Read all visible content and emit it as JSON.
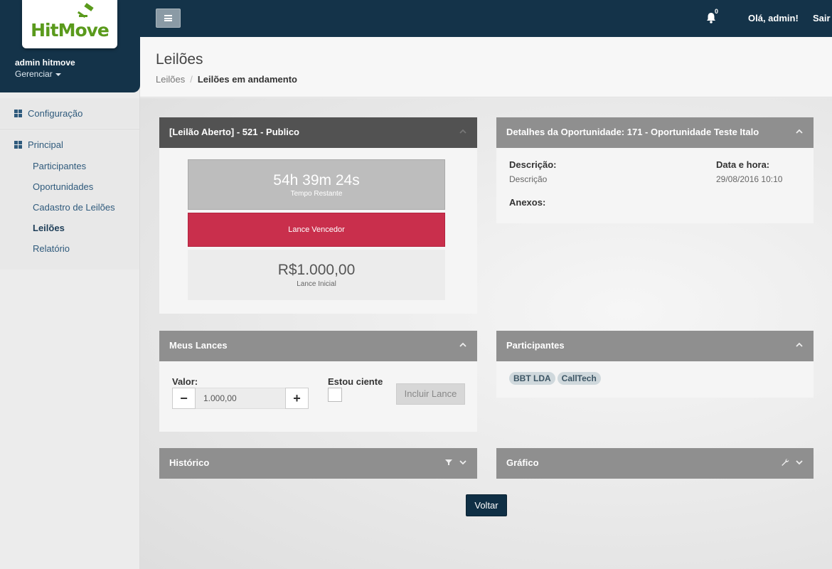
{
  "topbar": {
    "notification_count": "0",
    "greeting": "Olá, admin!",
    "logout_label": "Sair"
  },
  "sidebar": {
    "logo_text": "HitMove",
    "profile_name": "admin hitmove",
    "profile_menu": "Gerenciar",
    "sections": [
      {
        "label": "Configuração",
        "icon": "grid-icon"
      },
      {
        "label": "Principal",
        "icon": "grid-icon"
      }
    ],
    "items": [
      {
        "label": "Participantes"
      },
      {
        "label": "Oportunidades"
      },
      {
        "label": "Cadastro de Leilões"
      },
      {
        "label": "Leilões",
        "active": true
      },
      {
        "label": "Relatório"
      }
    ]
  },
  "page": {
    "title": "Leilões",
    "breadcrumb": [
      "Leilões",
      "Leilões em andamento"
    ]
  },
  "auction": {
    "title": "[Leilão Aberto] - 521 - Publico",
    "time_remaining": "54h 39m 24s",
    "time_remaining_label": "Tempo Restante",
    "winning_bid_label": "Lance Vencedor",
    "initial_bid": "R$1.000,00",
    "initial_bid_label": "Lance Inicial"
  },
  "details": {
    "title": "Detalhes da Oportunidade: 171 - Oportunidade Teste Italo",
    "description_label": "Descrição:",
    "description_value": "Descrição",
    "datetime_label": "Data e hora:",
    "datetime_value": "29/08/2016 10:10",
    "attachments_label": "Anexos:"
  },
  "my_bids": {
    "title": "Meus Lances",
    "value_label": "Valor:",
    "value": "1.000,00",
    "minus": "−",
    "plus": "+",
    "aware_label": "Estou ciente",
    "submit_label": "Incluir Lance"
  },
  "participants": {
    "title": "Participantes",
    "tags": [
      "BBT LDA",
      "CallTech"
    ]
  },
  "history": {
    "title": "Histórico"
  },
  "chart_panel": {
    "title": "Gráfico"
  },
  "actions": {
    "back_label": "Voltar"
  },
  "colors": {
    "topbar": "#143349",
    "winning_bid": "#c92f4c",
    "panel_header": "#8f8f8f",
    "panel_header_dark": "#525252",
    "logo_green": "#5a9a1c"
  }
}
